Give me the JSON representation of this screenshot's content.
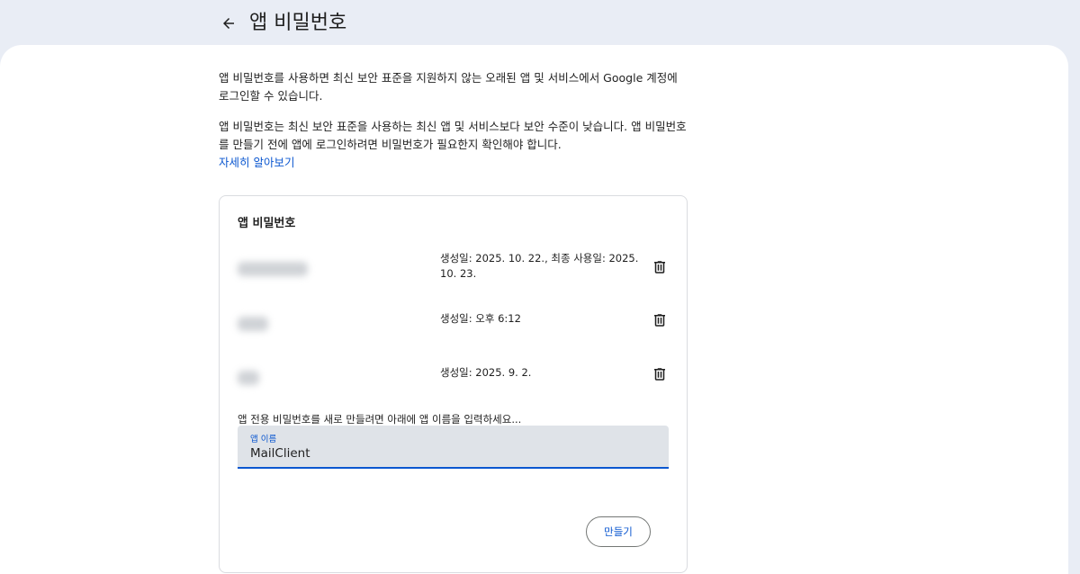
{
  "header": {
    "back_icon": "arrow-left-icon",
    "title": "앱 비밀번호"
  },
  "intro": {
    "paragraph1": "앱 비밀번호를 사용하면 최신 보안 표준을 지원하지 않는 오래된 앱 및 서비스에서 Google 계정에 로그인할 수 있습니다.",
    "paragraph2": "앱 비밀번호는 최신 보안 표준을 사용하는 최신 앱 및 서비스보다 보안 수준이 낮습니다. 앱 비밀번호를 만들기 전에 앱에 로그인하려면 비밀번호가 필요한지 확인해야 합니다.",
    "learn_more": "자세히 알아보기"
  },
  "card": {
    "title": "앱 비밀번호",
    "passwords": [
      {
        "name_redacted": true,
        "meta": "생성일: 2025. 10. 22., 최종 사용일: 2025. 10. 23.",
        "delete_icon": "trash-icon"
      },
      {
        "name_redacted": true,
        "meta": "생성일: 오후 6:12",
        "delete_icon": "trash-icon"
      },
      {
        "name_redacted": true,
        "meta": "생성일: 2025. 9. 2.",
        "delete_icon": "trash-icon"
      }
    ],
    "instruction": "앱 전용 비밀번호를 새로 만들려면 아래에 앱 이름을 입력하세요...",
    "input": {
      "label": "앱 이름",
      "value": "MailClient"
    },
    "create_label": "만들기"
  },
  "colors": {
    "page_bg": "#e9edf5",
    "accent": "#0b57d0",
    "field_bg": "#dfe3e8"
  }
}
